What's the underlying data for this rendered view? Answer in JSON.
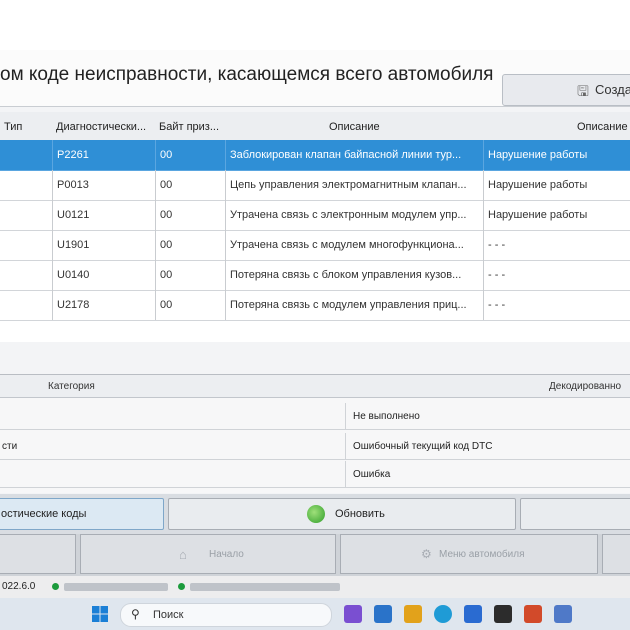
{
  "window": {
    "title": "ом коде неисправности, касающемся всего автомобиля",
    "create_button": "Созда"
  },
  "grid": {
    "columns": [
      "Тип",
      "Диагностически...",
      "Байт приз...",
      "Описание",
      "Описание"
    ],
    "rows": [
      {
        "code": "P2261",
        "byte": "00",
        "desc": "Заблокирован клапан байпасной линии тур...",
        "desc2": "Нарушение работы",
        "selected": true
      },
      {
        "code": "P0013",
        "byte": "00",
        "desc": "Цепь управления электромагнитным клапан...",
        "desc2": "Нарушение работы",
        "selected": false
      },
      {
        "code": "U0121",
        "byte": "00",
        "desc": "Утрачена связь с электронным модулем упр...",
        "desc2": "Нарушение работы",
        "selected": false
      },
      {
        "code": "U1901",
        "byte": "00",
        "desc": "Утрачена связь с модулем многофункциона...",
        "desc2": "- - -",
        "selected": false
      },
      {
        "code": "U0140",
        "byte": "00",
        "desc": "Потеряна связь с блоком управления кузов...",
        "desc2": "- - -",
        "selected": false
      },
      {
        "code": "U2178",
        "byte": "00",
        "desc": "Потеряна связь с модулем управления приц...",
        "desc2": "- - -",
        "selected": false
      }
    ]
  },
  "category_pane": {
    "header_left": "Категория",
    "header_right": "Декодированно",
    "rows": [
      {
        "left": "",
        "right": "Не выполнено"
      },
      {
        "left": "сти",
        "right": "Ошибочный текущий код DTC"
      },
      {
        "left": "",
        "right": "Ошибка"
      }
    ]
  },
  "buttons": {
    "dtc_codes": "остические коды",
    "refresh": "Обновить"
  },
  "nav": {
    "start": "Начало",
    "vehicle_menu": "Меню автомобиля"
  },
  "status": {
    "version": "022.6.0"
  },
  "taskbar": {
    "search_placeholder": "Поиск"
  },
  "colors": {
    "selected_row": "#2f8fd6",
    "status_green": "#1c9b3c"
  }
}
